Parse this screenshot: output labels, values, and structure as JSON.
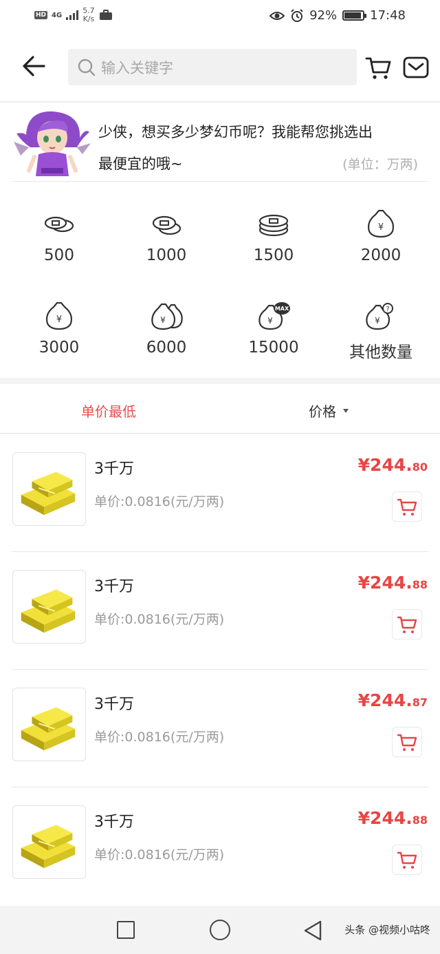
{
  "status_bar": {
    "hd": "HD",
    "network": "4G",
    "speed_value": "5.7",
    "speed_unit": "K/s",
    "battery": "92%",
    "battery_level": 0.92,
    "time": "17:48"
  },
  "header": {
    "search_placeholder": "输入关键字"
  },
  "hint": {
    "line1": "少侠，想买多少梦幻币呢？我能帮您挑选出",
    "line2": "最便宜的哦~",
    "unit": "(单位：万两)"
  },
  "amounts": [
    {
      "label": "500",
      "icon": "coins-small-icon"
    },
    {
      "label": "1000",
      "icon": "coins-medium-icon"
    },
    {
      "label": "1500",
      "icon": "coins-stack-icon"
    },
    {
      "label": "2000",
      "icon": "money-bag-icon"
    },
    {
      "label": "3000",
      "icon": "money-bag-icon"
    },
    {
      "label": "6000",
      "icon": "money-bags-icon"
    },
    {
      "label": "15000",
      "icon": "money-bag-max-icon"
    },
    {
      "label": "其他数量",
      "icon": "money-bag-question-icon"
    }
  ],
  "sort": {
    "unit_price_lowest": "单价最低",
    "price": "价格"
  },
  "products": [
    {
      "title": "3千万",
      "unit_price": "单价:0.0816(元/万两)",
      "currency": "¥",
      "price_int": "244.",
      "price_dec": "80"
    },
    {
      "title": "3千万",
      "unit_price": "单价:0.0816(元/万两)",
      "currency": "¥",
      "price_int": "244.",
      "price_dec": "88"
    },
    {
      "title": "3千万",
      "unit_price": "单价:0.0816(元/万两)",
      "currency": "¥",
      "price_int": "244.",
      "price_dec": "87"
    },
    {
      "title": "3千万",
      "unit_price": "单价:0.0816(元/万两)",
      "currency": "¥",
      "price_int": "244.",
      "price_dec": "88"
    }
  ],
  "watermark": "头条 @视频小咕咚",
  "colors": {
    "accent_red": "#e84545",
    "text_dark": "#222222",
    "text_grey": "#9a9a9a",
    "search_bg": "#f1f1f1"
  }
}
